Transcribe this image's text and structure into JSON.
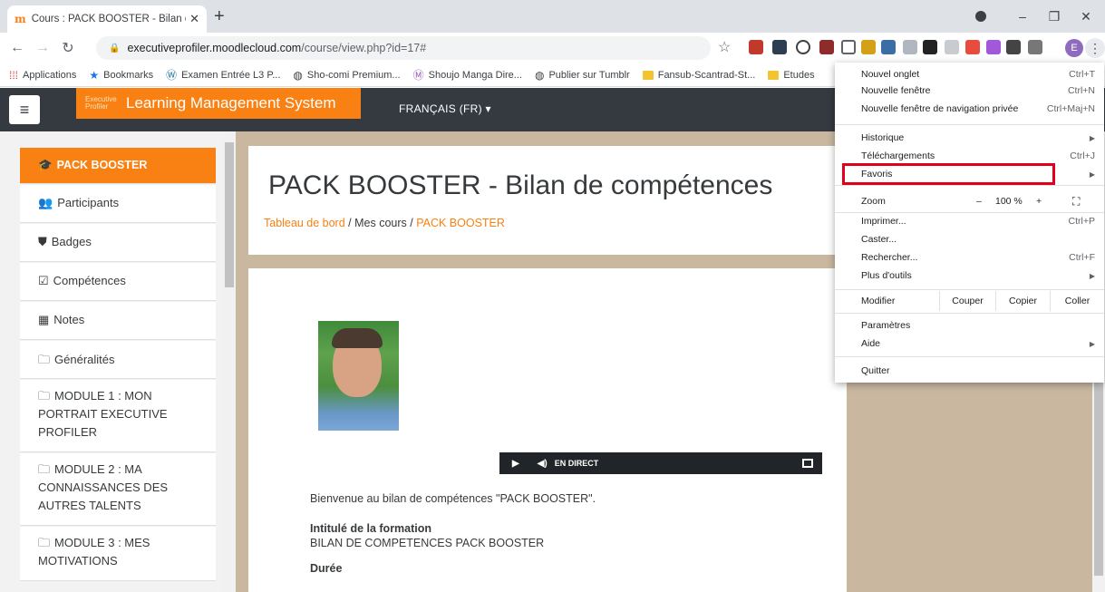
{
  "browser": {
    "tab_title": "Cours : PACK BOOSTER - Bilan de",
    "tab_favicon": "m",
    "tab_close": "✕",
    "new_tab": "+",
    "window_controls": {
      "minimize": "–",
      "restore": "❐",
      "close": "✕"
    },
    "url_host": "executiveprofiler.moodlecloud.com",
    "url_path": "/course/view.php?id=17#",
    "avatar_letter": "E",
    "bookmarks": [
      {
        "label": "Applications",
        "icon": "apps-grid-icon"
      },
      {
        "label": "Bookmarks",
        "icon": "star-icon"
      },
      {
        "label": "Examen Entrée L3 P...",
        "icon": "wordpress-icon"
      },
      {
        "label": "Sho-comi Premium...",
        "icon": "globe-icon"
      },
      {
        "label": "Shoujo Manga Dire...",
        "icon": "site-icon"
      },
      {
        "label": "Publier sur Tumblr",
        "icon": "globe-icon"
      },
      {
        "label": "Fansub-Scantrad-St...",
        "icon": "folder-icon"
      },
      {
        "label": "Etudes",
        "icon": "folder-icon"
      }
    ]
  },
  "moodle": {
    "brand_logo_lines": [
      "Executive",
      "Profiler"
    ],
    "brand": "Learning Management System",
    "language": "FRANÇAIS (FR) ▾",
    "drawer": [
      {
        "label": "PACK BOOSTER",
        "icon": "graduation-cap-icon",
        "glyph": "🎓",
        "active": true
      },
      {
        "label": "Participants",
        "icon": "users-icon",
        "glyph": "👥"
      },
      {
        "label": "Badges",
        "icon": "shield-icon",
        "glyph": "⛊"
      },
      {
        "label": "Compétences",
        "icon": "checkbox-icon",
        "glyph": "☑"
      },
      {
        "label": "Notes",
        "icon": "table-icon",
        "glyph": "▦"
      },
      {
        "label": "Généralités",
        "icon": "folder-icon",
        "glyph": "🗀"
      },
      {
        "label": "MODULE 1 : MON PORTRAIT EXECUTIVE PROFILER",
        "icon": "folder-icon",
        "glyph": "🗀"
      },
      {
        "label": "MODULE 2 : MA CONNAISSANCES DES AUTRES TALENTS",
        "icon": "folder-icon",
        "glyph": "🗀"
      },
      {
        "label": "MODULE 3 : MES MOTIVATIONS",
        "icon": "folder-icon",
        "glyph": "🗀"
      }
    ],
    "course_title": "PACK BOOSTER - Bilan de compétences",
    "breadcrumb": {
      "dashboard": "Tableau de bord",
      "sep": "/",
      "mycourses": "Mes cours",
      "current": "PACK BOOSTER"
    },
    "player": {
      "live": "EN DIRECT"
    },
    "welcome": "Bienvenue au bilan de compétences \"PACK BOOSTER\".",
    "section1_title": "Intitulé de la formation",
    "section1_value": "BILAN DE COMPETENCES PACK BOOSTER",
    "section2_title": "Durée"
  },
  "chrome_menu": {
    "new_tab": {
      "label": "Nouvel onglet",
      "shortcut": "Ctrl+T"
    },
    "new_window": {
      "label": "Nouvelle fenêtre",
      "shortcut": "Ctrl+N"
    },
    "incognito": {
      "label": "Nouvelle fenêtre de navigation privée",
      "shortcut": "Ctrl+Maj+N"
    },
    "history": {
      "label": "Historique"
    },
    "downloads": {
      "label": "Téléchargements",
      "shortcut": "Ctrl+J"
    },
    "bookmarks": {
      "label": "Favoris"
    },
    "zoom": {
      "label": "Zoom",
      "minus": "–",
      "value": "100 %",
      "plus": "+"
    },
    "print": {
      "label": "Imprimer...",
      "shortcut": "Ctrl+P"
    },
    "cast": {
      "label": "Caster..."
    },
    "find": {
      "label": "Rechercher...",
      "shortcut": "Ctrl+F"
    },
    "more_tools": {
      "label": "Plus d'outils"
    },
    "edit": {
      "label": "Modifier",
      "cut": "Couper",
      "copy": "Copier",
      "paste": "Coller"
    },
    "settings": {
      "label": "Paramètres"
    },
    "help": {
      "label": "Aide"
    },
    "quit": {
      "label": "Quitter"
    }
  },
  "colors": {
    "accent": "#f98012",
    "navbar": "#343a40",
    "highlight": "#e0001b"
  }
}
